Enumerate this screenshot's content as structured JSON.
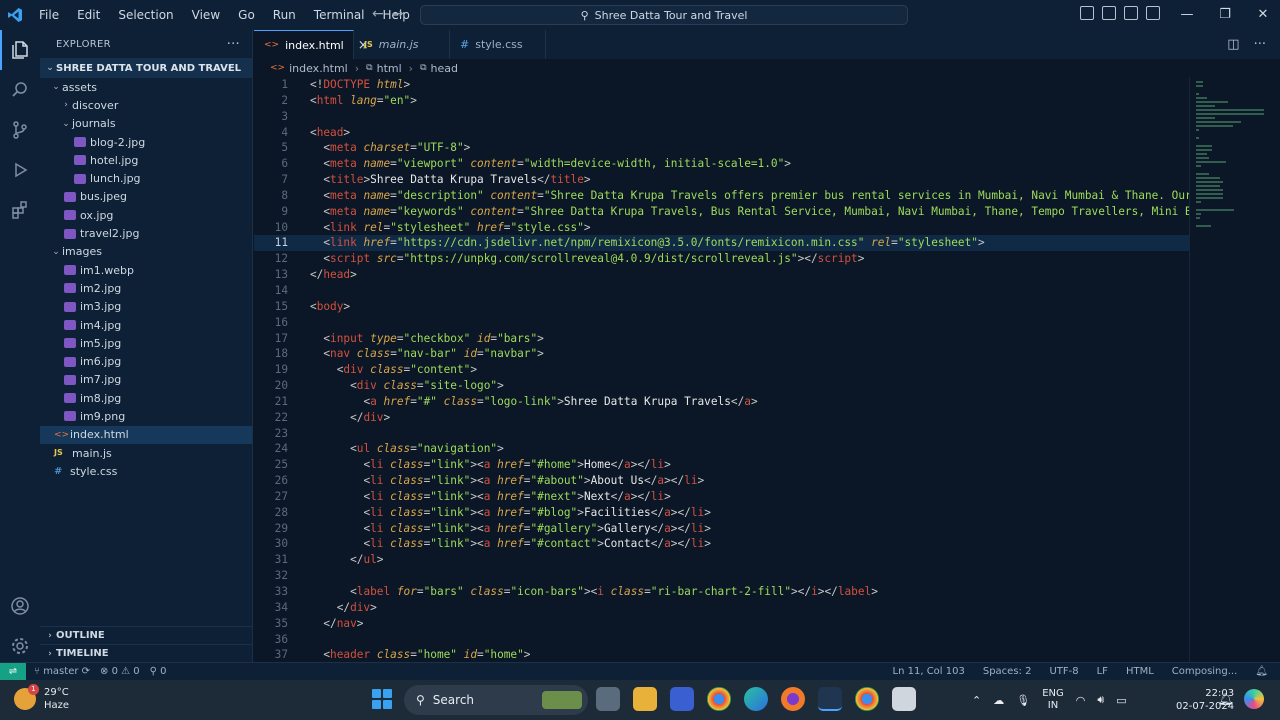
{
  "window": {
    "menu": [
      "File",
      "Edit",
      "Selection",
      "View",
      "Go",
      "Run",
      "Terminal",
      "Help"
    ],
    "command_center": "Shree Datta Tour and Travel"
  },
  "sidebar": {
    "title": "EXPLORER",
    "more": "···",
    "project": "SHREE DATTA TOUR AND TRAVEL",
    "tree": [
      {
        "label": "assets",
        "type": "folder",
        "depth": 1,
        "open": true
      },
      {
        "label": "discover",
        "type": "folder",
        "depth": 2,
        "open": false
      },
      {
        "label": "journals",
        "type": "folder",
        "depth": 2,
        "open": true
      },
      {
        "label": "blog-2.jpg",
        "type": "img",
        "depth": 3
      },
      {
        "label": "hotel.jpg",
        "type": "img",
        "depth": 3
      },
      {
        "label": "lunch.jpg",
        "type": "img",
        "depth": 3
      },
      {
        "label": "bus.jpeg",
        "type": "img",
        "depth": 2
      },
      {
        "label": "ox.jpg",
        "type": "img",
        "depth": 2
      },
      {
        "label": "travel2.jpg",
        "type": "img",
        "depth": 2
      },
      {
        "label": "images",
        "type": "folder",
        "depth": 1,
        "open": true
      },
      {
        "label": "im1.webp",
        "type": "img",
        "depth": 2
      },
      {
        "label": "im2.jpg",
        "type": "img",
        "depth": 2
      },
      {
        "label": "im3.jpg",
        "type": "img",
        "depth": 2
      },
      {
        "label": "im4.jpg",
        "type": "img",
        "depth": 2
      },
      {
        "label": "im5.jpg",
        "type": "img",
        "depth": 2
      },
      {
        "label": "im6.jpg",
        "type": "img",
        "depth": 2
      },
      {
        "label": "im7.jpg",
        "type": "img",
        "depth": 2
      },
      {
        "label": "im8.jpg",
        "type": "img",
        "depth": 2
      },
      {
        "label": "im9.png",
        "type": "img",
        "depth": 2
      },
      {
        "label": "index.html",
        "type": "html",
        "depth": 1,
        "selected": true
      },
      {
        "label": "main.js",
        "type": "js",
        "depth": 1
      },
      {
        "label": "style.css",
        "type": "css",
        "depth": 1
      }
    ],
    "outline": "OUTLINE",
    "timeline": "TIMELINE"
  },
  "tabs": [
    {
      "label": "index.html",
      "type": "html",
      "active": true,
      "close": "×"
    },
    {
      "label": "main.js",
      "type": "js",
      "active": false
    },
    {
      "label": "style.css",
      "type": "css",
      "active": false
    }
  ],
  "icons": {
    "js": "JS",
    "css": "#",
    "html": "<>"
  },
  "breadcrumb": [
    "index.html",
    "html",
    "head"
  ],
  "current_line": 11,
  "code_lines": [
    [
      [
        "pu",
        "<!"
      ],
      [
        "tg",
        "DOCTYPE"
      ],
      [
        "tx",
        " "
      ],
      [
        "at",
        "html"
      ],
      [
        "pu",
        ">"
      ]
    ],
    [
      [
        "pu",
        "<"
      ],
      [
        "tg",
        "html"
      ],
      [
        "tx",
        " "
      ],
      [
        "at",
        "lang"
      ],
      [
        "pu",
        "="
      ],
      [
        "st",
        "\"en\""
      ],
      [
        "pu",
        ">"
      ]
    ],
    [],
    [
      [
        "pu",
        "<"
      ],
      [
        "tg",
        "head"
      ],
      [
        "pu",
        ">"
      ]
    ],
    [
      [
        "tx",
        "  "
      ],
      [
        "pu",
        "<"
      ],
      [
        "tg",
        "meta"
      ],
      [
        "tx",
        " "
      ],
      [
        "at",
        "charset"
      ],
      [
        "pu",
        "="
      ],
      [
        "st",
        "\"UTF-8\""
      ],
      [
        "pu",
        ">"
      ]
    ],
    [
      [
        "tx",
        "  "
      ],
      [
        "pu",
        "<"
      ],
      [
        "tg",
        "meta"
      ],
      [
        "tx",
        " "
      ],
      [
        "at",
        "name"
      ],
      [
        "pu",
        "="
      ],
      [
        "st",
        "\"viewport\""
      ],
      [
        "tx",
        " "
      ],
      [
        "at",
        "content"
      ],
      [
        "pu",
        "="
      ],
      [
        "st",
        "\"width=device-width, initial-scale=1.0\""
      ],
      [
        "pu",
        ">"
      ]
    ],
    [
      [
        "tx",
        "  "
      ],
      [
        "pu",
        "<"
      ],
      [
        "tg",
        "title"
      ],
      [
        "pu",
        ">"
      ],
      [
        "tx",
        "Shree Datta Krupa Travels"
      ],
      [
        "pu",
        "</"
      ],
      [
        "tg",
        "title"
      ],
      [
        "pu",
        ">"
      ]
    ],
    [
      [
        "tx",
        "  "
      ],
      [
        "pu",
        "<"
      ],
      [
        "tg",
        "meta"
      ],
      [
        "tx",
        " "
      ],
      [
        "at",
        "name"
      ],
      [
        "pu",
        "="
      ],
      [
        "st",
        "\"description\""
      ],
      [
        "tx",
        " "
      ],
      [
        "at",
        "content"
      ],
      [
        "pu",
        "="
      ],
      [
        "st",
        "\"Shree Datta Krupa Travels offers premier bus rental services in Mumbai, Navi Mumbai & Thane. Our fleet includes Te"
      ]
    ],
    [
      [
        "tx",
        "  "
      ],
      [
        "pu",
        "<"
      ],
      [
        "tg",
        "meta"
      ],
      [
        "tx",
        " "
      ],
      [
        "at",
        "name"
      ],
      [
        "pu",
        "="
      ],
      [
        "st",
        "\"keywords\""
      ],
      [
        "tx",
        " "
      ],
      [
        "at",
        "content"
      ],
      [
        "pu",
        "="
      ],
      [
        "st",
        "\"Shree Datta Krupa Travels, Bus Rental Service, Mumbai, Navi Mumbai, Thane, Tempo Travellers, Mini Buses, Buses, Corpo"
      ]
    ],
    [
      [
        "tx",
        "  "
      ],
      [
        "pu",
        "<"
      ],
      [
        "tg",
        "link"
      ],
      [
        "tx",
        " "
      ],
      [
        "at",
        "rel"
      ],
      [
        "pu",
        "="
      ],
      [
        "st",
        "\"stylesheet\""
      ],
      [
        "tx",
        " "
      ],
      [
        "at",
        "href"
      ],
      [
        "pu",
        "="
      ],
      [
        "st",
        "\"style.css\""
      ],
      [
        "pu",
        ">"
      ]
    ],
    [
      [
        "tx",
        "  "
      ],
      [
        "pu",
        "<"
      ],
      [
        "tg",
        "link"
      ],
      [
        "tx",
        " "
      ],
      [
        "at",
        "href"
      ],
      [
        "pu",
        "="
      ],
      [
        "st",
        "\"https://cdn.jsdelivr.net/npm/remixicon@3.5.0/fonts/remixicon.min.css\""
      ],
      [
        "tx",
        " "
      ],
      [
        "at",
        "rel"
      ],
      [
        "pu",
        "="
      ],
      [
        "st",
        "\"stylesheet\""
      ],
      [
        "pu",
        ">"
      ]
    ],
    [
      [
        "tx",
        "  "
      ],
      [
        "pu",
        "<"
      ],
      [
        "tg",
        "script"
      ],
      [
        "tx",
        " "
      ],
      [
        "at",
        "src"
      ],
      [
        "pu",
        "="
      ],
      [
        "st",
        "\"https://unpkg.com/scrollreveal@4.0.9/dist/scrollreveal.js\""
      ],
      [
        "pu",
        "></"
      ],
      [
        "tg",
        "script"
      ],
      [
        "pu",
        ">"
      ]
    ],
    [
      [
        "pu",
        "</"
      ],
      [
        "tg",
        "head"
      ],
      [
        "pu",
        ">"
      ]
    ],
    [],
    [
      [
        "pu",
        "<"
      ],
      [
        "tg",
        "body"
      ],
      [
        "pu",
        ">"
      ]
    ],
    [],
    [
      [
        "tx",
        "  "
      ],
      [
        "pu",
        "<"
      ],
      [
        "tg",
        "input"
      ],
      [
        "tx",
        " "
      ],
      [
        "at",
        "type"
      ],
      [
        "pu",
        "="
      ],
      [
        "st",
        "\"checkbox\""
      ],
      [
        "tx",
        " "
      ],
      [
        "at",
        "id"
      ],
      [
        "pu",
        "="
      ],
      [
        "st",
        "\"bars\""
      ],
      [
        "pu",
        ">"
      ]
    ],
    [
      [
        "tx",
        "  "
      ],
      [
        "pu",
        "<"
      ],
      [
        "tg",
        "nav"
      ],
      [
        "tx",
        " "
      ],
      [
        "at",
        "class"
      ],
      [
        "pu",
        "="
      ],
      [
        "st",
        "\"nav-bar\""
      ],
      [
        "tx",
        " "
      ],
      [
        "at",
        "id"
      ],
      [
        "pu",
        "="
      ],
      [
        "st",
        "\"navbar\""
      ],
      [
        "pu",
        ">"
      ]
    ],
    [
      [
        "tx",
        "    "
      ],
      [
        "pu",
        "<"
      ],
      [
        "tg",
        "div"
      ],
      [
        "tx",
        " "
      ],
      [
        "at",
        "class"
      ],
      [
        "pu",
        "="
      ],
      [
        "st",
        "\"content\""
      ],
      [
        "pu",
        ">"
      ]
    ],
    [
      [
        "tx",
        "      "
      ],
      [
        "pu",
        "<"
      ],
      [
        "tg",
        "div"
      ],
      [
        "tx",
        " "
      ],
      [
        "at",
        "class"
      ],
      [
        "pu",
        "="
      ],
      [
        "st",
        "\"site-logo\""
      ],
      [
        "pu",
        ">"
      ]
    ],
    [
      [
        "tx",
        "        "
      ],
      [
        "pu",
        "<"
      ],
      [
        "tg",
        "a"
      ],
      [
        "tx",
        " "
      ],
      [
        "at",
        "href"
      ],
      [
        "pu",
        "="
      ],
      [
        "st",
        "\"#\""
      ],
      [
        "tx",
        " "
      ],
      [
        "at",
        "class"
      ],
      [
        "pu",
        "="
      ],
      [
        "st",
        "\"logo-link\""
      ],
      [
        "pu",
        ">"
      ],
      [
        "tx",
        "Shree Datta Krupa Travels"
      ],
      [
        "pu",
        "</"
      ],
      [
        "tg",
        "a"
      ],
      [
        "pu",
        ">"
      ]
    ],
    [
      [
        "tx",
        "      "
      ],
      [
        "pu",
        "</"
      ],
      [
        "tg",
        "div"
      ],
      [
        "pu",
        ">"
      ]
    ],
    [],
    [
      [
        "tx",
        "      "
      ],
      [
        "pu",
        "<"
      ],
      [
        "tg",
        "ul"
      ],
      [
        "tx",
        " "
      ],
      [
        "at",
        "class"
      ],
      [
        "pu",
        "="
      ],
      [
        "st",
        "\"navigation\""
      ],
      [
        "pu",
        ">"
      ]
    ],
    [
      [
        "tx",
        "        "
      ],
      [
        "pu",
        "<"
      ],
      [
        "tg",
        "li"
      ],
      [
        "tx",
        " "
      ],
      [
        "at",
        "class"
      ],
      [
        "pu",
        "="
      ],
      [
        "st",
        "\"link\""
      ],
      [
        "pu",
        "><"
      ],
      [
        "tg",
        "a"
      ],
      [
        "tx",
        " "
      ],
      [
        "at",
        "href"
      ],
      [
        "pu",
        "="
      ],
      [
        "st",
        "\"#home\""
      ],
      [
        "pu",
        ">"
      ],
      [
        "tx",
        "Home"
      ],
      [
        "pu",
        "</"
      ],
      [
        "tg",
        "a"
      ],
      [
        "pu",
        "></"
      ],
      [
        "tg",
        "li"
      ],
      [
        "pu",
        ">"
      ]
    ],
    [
      [
        "tx",
        "        "
      ],
      [
        "pu",
        "<"
      ],
      [
        "tg",
        "li"
      ],
      [
        "tx",
        " "
      ],
      [
        "at",
        "class"
      ],
      [
        "pu",
        "="
      ],
      [
        "st",
        "\"link\""
      ],
      [
        "pu",
        "><"
      ],
      [
        "tg",
        "a"
      ],
      [
        "tx",
        " "
      ],
      [
        "at",
        "href"
      ],
      [
        "pu",
        "="
      ],
      [
        "st",
        "\"#about\""
      ],
      [
        "pu",
        ">"
      ],
      [
        "tx",
        "About Us"
      ],
      [
        "pu",
        "</"
      ],
      [
        "tg",
        "a"
      ],
      [
        "pu",
        "></"
      ],
      [
        "tg",
        "li"
      ],
      [
        "pu",
        ">"
      ]
    ],
    [
      [
        "tx",
        "        "
      ],
      [
        "pu",
        "<"
      ],
      [
        "tg",
        "li"
      ],
      [
        "tx",
        " "
      ],
      [
        "at",
        "class"
      ],
      [
        "pu",
        "="
      ],
      [
        "st",
        "\"link\""
      ],
      [
        "pu",
        "><"
      ],
      [
        "tg",
        "a"
      ],
      [
        "tx",
        " "
      ],
      [
        "at",
        "href"
      ],
      [
        "pu",
        "="
      ],
      [
        "st",
        "\"#next\""
      ],
      [
        "pu",
        ">"
      ],
      [
        "tx",
        "Next"
      ],
      [
        "pu",
        "</"
      ],
      [
        "tg",
        "a"
      ],
      [
        "pu",
        "></"
      ],
      [
        "tg",
        "li"
      ],
      [
        "pu",
        ">"
      ]
    ],
    [
      [
        "tx",
        "        "
      ],
      [
        "pu",
        "<"
      ],
      [
        "tg",
        "li"
      ],
      [
        "tx",
        " "
      ],
      [
        "at",
        "class"
      ],
      [
        "pu",
        "="
      ],
      [
        "st",
        "\"link\""
      ],
      [
        "pu",
        "><"
      ],
      [
        "tg",
        "a"
      ],
      [
        "tx",
        " "
      ],
      [
        "at",
        "href"
      ],
      [
        "pu",
        "="
      ],
      [
        "st",
        "\"#blog\""
      ],
      [
        "pu",
        ">"
      ],
      [
        "tx",
        "Facilities"
      ],
      [
        "pu",
        "</"
      ],
      [
        "tg",
        "a"
      ],
      [
        "pu",
        "></"
      ],
      [
        "tg",
        "li"
      ],
      [
        "pu",
        ">"
      ]
    ],
    [
      [
        "tx",
        "        "
      ],
      [
        "pu",
        "<"
      ],
      [
        "tg",
        "li"
      ],
      [
        "tx",
        " "
      ],
      [
        "at",
        "class"
      ],
      [
        "pu",
        "="
      ],
      [
        "st",
        "\"link\""
      ],
      [
        "pu",
        "><"
      ],
      [
        "tg",
        "a"
      ],
      [
        "tx",
        " "
      ],
      [
        "at",
        "href"
      ],
      [
        "pu",
        "="
      ],
      [
        "st",
        "\"#gallery\""
      ],
      [
        "pu",
        ">"
      ],
      [
        "tx",
        "Gallery"
      ],
      [
        "pu",
        "</"
      ],
      [
        "tg",
        "a"
      ],
      [
        "pu",
        "></"
      ],
      [
        "tg",
        "li"
      ],
      [
        "pu",
        ">"
      ]
    ],
    [
      [
        "tx",
        "        "
      ],
      [
        "pu",
        "<"
      ],
      [
        "tg",
        "li"
      ],
      [
        "tx",
        " "
      ],
      [
        "at",
        "class"
      ],
      [
        "pu",
        "="
      ],
      [
        "st",
        "\"link\""
      ],
      [
        "pu",
        "><"
      ],
      [
        "tg",
        "a"
      ],
      [
        "tx",
        " "
      ],
      [
        "at",
        "href"
      ],
      [
        "pu",
        "="
      ],
      [
        "st",
        "\"#contact\""
      ],
      [
        "pu",
        ">"
      ],
      [
        "tx",
        "Contact"
      ],
      [
        "pu",
        "</"
      ],
      [
        "tg",
        "a"
      ],
      [
        "pu",
        "></"
      ],
      [
        "tg",
        "li"
      ],
      [
        "pu",
        ">"
      ]
    ],
    [
      [
        "tx",
        "      "
      ],
      [
        "pu",
        "</"
      ],
      [
        "tg",
        "ul"
      ],
      [
        "pu",
        ">"
      ]
    ],
    [],
    [
      [
        "tx",
        "      "
      ],
      [
        "pu",
        "<"
      ],
      [
        "tg",
        "label"
      ],
      [
        "tx",
        " "
      ],
      [
        "at",
        "for"
      ],
      [
        "pu",
        "="
      ],
      [
        "st",
        "\"bars\""
      ],
      [
        "tx",
        " "
      ],
      [
        "at",
        "class"
      ],
      [
        "pu",
        "="
      ],
      [
        "st",
        "\"icon-bars\""
      ],
      [
        "pu",
        "><"
      ],
      [
        "tg",
        "i"
      ],
      [
        "tx",
        " "
      ],
      [
        "at",
        "class"
      ],
      [
        "pu",
        "="
      ],
      [
        "st",
        "\"ri-bar-chart-2-fill\""
      ],
      [
        "pu",
        "></"
      ],
      [
        "tg",
        "i"
      ],
      [
        "pu",
        "></"
      ],
      [
        "tg",
        "label"
      ],
      [
        "pu",
        ">"
      ]
    ],
    [
      [
        "tx",
        "    "
      ],
      [
        "pu",
        "</"
      ],
      [
        "tg",
        "div"
      ],
      [
        "pu",
        ">"
      ]
    ],
    [
      [
        "tx",
        "  "
      ],
      [
        "pu",
        "</"
      ],
      [
        "tg",
        "nav"
      ],
      [
        "pu",
        ">"
      ]
    ],
    [],
    [
      [
        "tx",
        "  "
      ],
      [
        "pu",
        "<"
      ],
      [
        "tg",
        "header"
      ],
      [
        "tx",
        " "
      ],
      [
        "at",
        "class"
      ],
      [
        "pu",
        "="
      ],
      [
        "st",
        "\"home\""
      ],
      [
        "tx",
        " "
      ],
      [
        "at",
        "id"
      ],
      [
        "pu",
        "="
      ],
      [
        "st",
        "\"home\""
      ],
      [
        "pu",
        ">"
      ]
    ]
  ],
  "statusbar": {
    "branch": "master",
    "problems": "⊗ 0 ⚠ 0",
    "ports": "⚲ 0",
    "position": "Ln 11, Col 103",
    "spaces": "Spaces: 2",
    "encoding": "UTF-8",
    "eol": "LF",
    "language": "HTML",
    "status": "Composing..."
  },
  "taskbar": {
    "temp": "29°C",
    "weather": "Haze",
    "badge": "1",
    "search": "Search",
    "lang1": "ENG",
    "lang2": "IN",
    "time": "22:03",
    "date": "02-07-2024"
  },
  "colors": {
    "accent": "#4aa3ff",
    "remote": "#16a085"
  }
}
